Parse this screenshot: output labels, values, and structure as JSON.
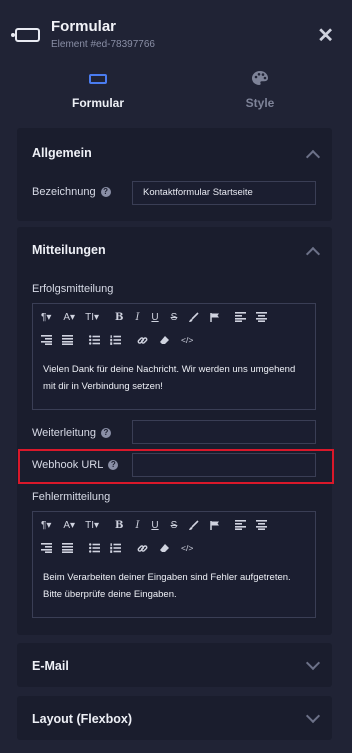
{
  "header": {
    "title": "Formular",
    "subtitle": "Element #ed-78397766",
    "close_label": "✕"
  },
  "tabs": [
    {
      "label": "Formular"
    },
    {
      "label": "Style"
    }
  ],
  "allgemein": {
    "title": "Allgemein",
    "bezeichnung_label": "Bezeichnung",
    "bezeichnung_value": "Kontaktformular Startseite"
  },
  "mitteilungen": {
    "title": "Mitteilungen",
    "erfolg_label": "Erfolgsmitteilung",
    "erfolg_text": "Vielen Dank für deine Nachricht. Wir werden uns umgehend mit dir in Verbindung setzen!",
    "weiterleitung_label": "Weiterleitung",
    "weiterleitung_value": "",
    "webhook_label": "Webhook URL",
    "webhook_value": "",
    "fehler_label": "Fehlermitteilung",
    "fehler_text": "Beim Verarbeiten deiner Eingaben sind Fehler aufgetreten. Bitte überprüfe deine Eingaben."
  },
  "email": {
    "title": "E-Mail"
  },
  "layout": {
    "title": "Layout (Flexbox)"
  },
  "toolbar": {
    "paragraph": "¶▾",
    "font": "A▾",
    "size": "TI▾",
    "bold": "B",
    "italic": "I",
    "underline": "U",
    "strike": "S",
    "code": "</>"
  },
  "help_glyph": "?",
  "colors": {
    "background": "#202335",
    "card": "#1a1d2d",
    "accent": "#4a7cf0",
    "highlight": "#d9182a"
  }
}
